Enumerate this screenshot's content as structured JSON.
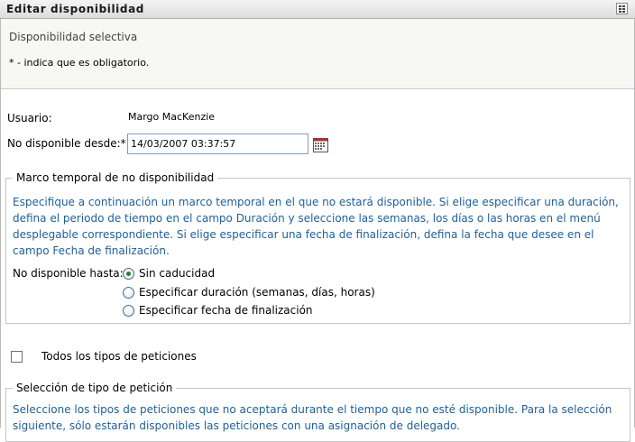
{
  "titlebar": {
    "title": "Editar disponibilidad",
    "menu_icon": "grid-menu-icon"
  },
  "header": {
    "subtitle": "Disponibilidad selectiva",
    "required_note": "* - indica que es obligatorio."
  },
  "form": {
    "user_label": "Usuario:",
    "user_value": "Margo MacKenzie",
    "unavailable_from_label": "No disponible desde:*",
    "unavailable_from_value": "14/03/2007 03:37:57",
    "calendar_icon": "calendar-icon"
  },
  "timeframe": {
    "legend": "Marco temporal de no disponibilidad",
    "help_text": "Especifique a continuación un marco temporal en el que no estará disponible. Si elige especificar una duración, defina el periodo de tiempo en el campo Duración y seleccione las semanas, los días o las horas en el menú desplegable correspondiente. Si elige especificar una fecha de finalización, defina la fecha que desee en el campo Fecha de finalización.",
    "until_label": "No disponible hasta:*",
    "options": [
      {
        "label": "Sin caducidad",
        "selected": true
      },
      {
        "label": "Especificar duración (semanas, días, horas)",
        "selected": false
      },
      {
        "label": "Especificar fecha de finalización",
        "selected": false
      }
    ]
  },
  "all_requests": {
    "label": "Todos los tipos de peticiones",
    "checked": false
  },
  "request_selection": {
    "legend": "Selección de tipo de petición",
    "help_text": "Seleccione los tipos de peticiones que no aceptará durante el tiempo que no esté disponible. Para la selección siguiente, sólo estarán disponibles las peticiones con una asignación de delegado."
  },
  "colors": {
    "help_text": "#1f5f99",
    "radio_selected": "#2d7a2d",
    "input_border": "#7f9db9"
  }
}
